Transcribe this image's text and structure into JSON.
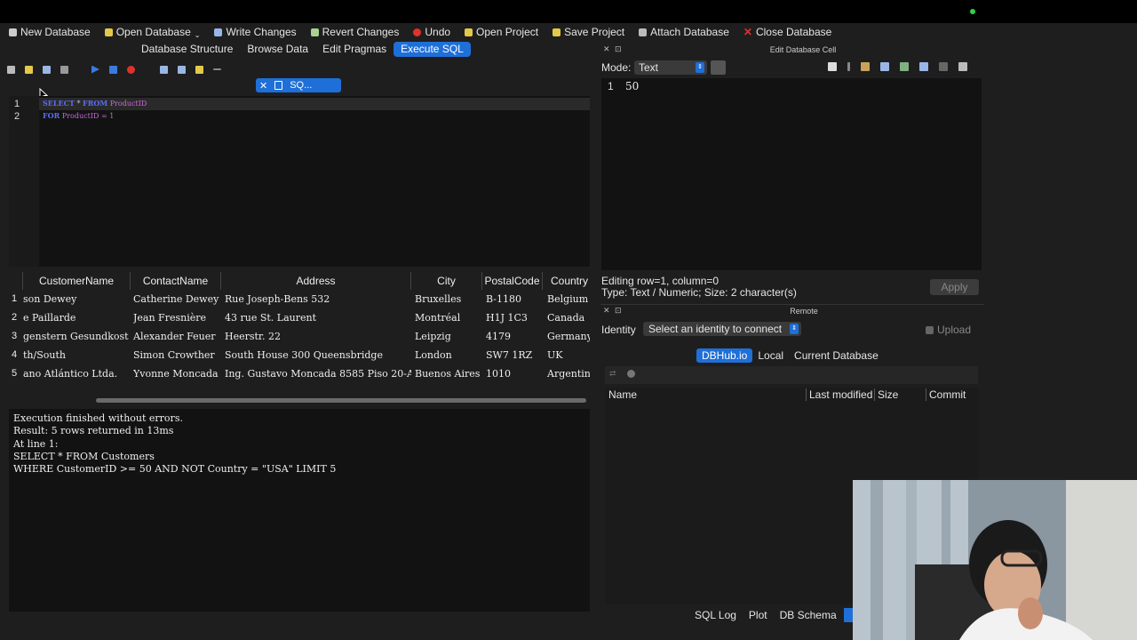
{
  "toolbar": {
    "new_database": "New Database",
    "open_database": "Open Database",
    "write_changes": "Write Changes",
    "revert_changes": "Revert Changes",
    "undo": "Undo",
    "open_project": "Open Project",
    "save_project": "Save Project",
    "attach_database": "Attach Database",
    "close_database": "Close Database"
  },
  "tabs": [
    "Database Structure",
    "Browse Data",
    "Edit Pragmas",
    "Execute SQL"
  ],
  "active_tab": "Execute SQL",
  "editor": {
    "tab_label": "SQ...",
    "lines": [
      {
        "num": "1",
        "kw1": "SELECT",
        "mid": " * ",
        "kw2": "FROM",
        "rest": " ProductID"
      },
      {
        "num": "2",
        "kw1": "FOR",
        "mid": " ",
        "kw2": "",
        "rest": "ProductID = 1"
      }
    ]
  },
  "results": {
    "columns": [
      "CustomerName",
      "ContactName",
      "Address",
      "City",
      "PostalCode",
      "Country"
    ],
    "rows": [
      {
        "num": "1",
        "cells": [
          "son Dewey",
          "Catherine Dewey",
          "Rue Joseph-Bens 532",
          "Bruxelles",
          "B-1180",
          "Belgium"
        ]
      },
      {
        "num": "2",
        "cells": [
          "e Paillarde",
          "Jean Fresnière",
          "43 rue St. Laurent",
          "Montréal",
          "H1J 1C3",
          "Canada"
        ]
      },
      {
        "num": "3",
        "cells": [
          "genstern Gesundkost",
          "Alexander Feuer",
          "Heerstr. 22",
          "Leipzig",
          "4179",
          "Germany"
        ]
      },
      {
        "num": "4",
        "cells": [
          "th/South",
          "Simon Crowther",
          "South House 300 Queensbridge",
          "London",
          "SW7 1RZ",
          "UK"
        ]
      },
      {
        "num": "5",
        "cells": [
          "ano Atlántico Ltda.",
          "Yvonne Moncada",
          "Ing. Gustavo Moncada 8585 Piso 20-A",
          "Buenos Aires",
          "1010",
          "Argentin"
        ]
      }
    ]
  },
  "messages": [
    "Execution finished without errors.",
    "Result: 5 rows returned in 13ms",
    "At line 1:",
    "SELECT * FROM Customers",
    "WHERE CustomerID >= 50 AND NOT Country = \"USA\" LIMIT 5"
  ],
  "edit_cell": {
    "title": "Edit Database Cell",
    "mode_label": "Mode:",
    "mode_value": "Text",
    "line_num": "1",
    "value": "50",
    "status_position": "Editing row=1, column=0",
    "status_type": "Type: Text / Numeric; Size: 2 character(s)",
    "apply": "Apply"
  },
  "remote": {
    "title": "Remote",
    "identity_label": "Identity",
    "identity_placeholder": "Select an identity to connect",
    "upload": "Upload",
    "segments": [
      "DBHub.io",
      "Local",
      "Current Database"
    ],
    "active_segment": "DBHub.io",
    "columns": [
      "Name",
      "Last modified",
      "Size",
      "Commit"
    ]
  },
  "bottom_tabs": [
    "SQL Log",
    "Plot",
    "DB Schema"
  ],
  "colors": {
    "accent": "#1f6fd8",
    "keyword": "#5b6ef0",
    "identifier": "#c76bd7",
    "status_green": "#2bd24b",
    "close_red": "#e0322b"
  }
}
